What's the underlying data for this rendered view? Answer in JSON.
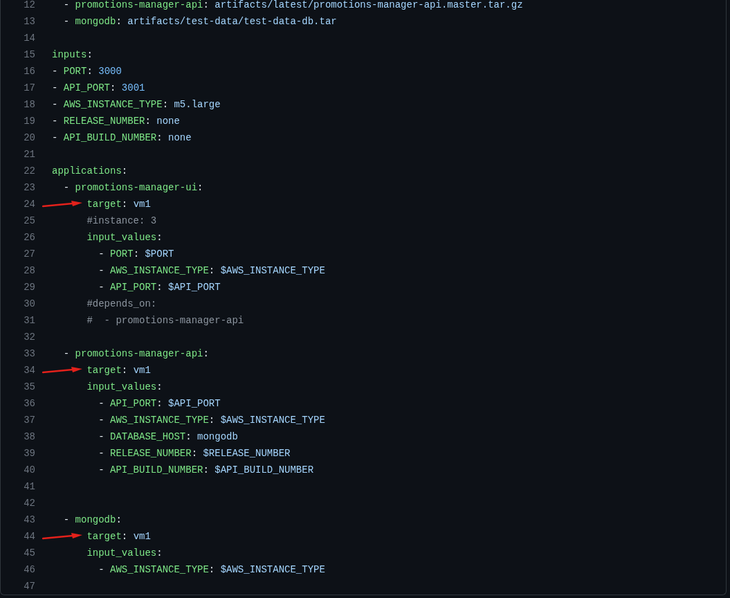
{
  "code_lines": [
    {
      "number": "12",
      "segments": [
        {
          "kind": "punct",
          "text": "  - "
        },
        {
          "kind": "key",
          "text": "promotions-manager-api"
        },
        {
          "kind": "punct",
          "text": ": "
        },
        {
          "kind": "string",
          "text": "artifacts/latest/promotions-manager-api.master.tar.gz"
        }
      ]
    },
    {
      "number": "13",
      "segments": [
        {
          "kind": "punct",
          "text": "  - "
        },
        {
          "kind": "key",
          "text": "mongodb"
        },
        {
          "kind": "punct",
          "text": ": "
        },
        {
          "kind": "string",
          "text": "artifacts/test-data/test-data-db.tar"
        }
      ]
    },
    {
      "number": "14"
    },
    {
      "number": "15",
      "segments": [
        {
          "kind": "key",
          "text": "inputs"
        },
        {
          "kind": "punct",
          "text": ":"
        }
      ]
    },
    {
      "number": "16",
      "segments": [
        {
          "kind": "punct",
          "text": "- "
        },
        {
          "kind": "key",
          "text": "PORT"
        },
        {
          "kind": "punct",
          "text": ": "
        },
        {
          "kind": "number",
          "text": "3000"
        }
      ]
    },
    {
      "number": "17",
      "segments": [
        {
          "kind": "punct",
          "text": "- "
        },
        {
          "kind": "key",
          "text": "API_PORT"
        },
        {
          "kind": "punct",
          "text": ": "
        },
        {
          "kind": "number",
          "text": "3001"
        }
      ]
    },
    {
      "number": "18",
      "segments": [
        {
          "kind": "punct",
          "text": "- "
        },
        {
          "kind": "key",
          "text": "AWS_INSTANCE_TYPE"
        },
        {
          "kind": "punct",
          "text": ": "
        },
        {
          "kind": "string",
          "text": "m5.large"
        }
      ]
    },
    {
      "number": "19",
      "segments": [
        {
          "kind": "punct",
          "text": "- "
        },
        {
          "kind": "key",
          "text": "RELEASE_NUMBER"
        },
        {
          "kind": "punct",
          "text": ": "
        },
        {
          "kind": "string",
          "text": "none"
        }
      ]
    },
    {
      "number": "20",
      "segments": [
        {
          "kind": "punct",
          "text": "- "
        },
        {
          "kind": "key",
          "text": "API_BUILD_NUMBER"
        },
        {
          "kind": "punct",
          "text": ": "
        },
        {
          "kind": "string",
          "text": "none"
        }
      ]
    },
    {
      "number": "21"
    },
    {
      "number": "22",
      "segments": [
        {
          "kind": "key",
          "text": "applications"
        },
        {
          "kind": "punct",
          "text": ":"
        }
      ]
    },
    {
      "number": "23",
      "segments": [
        {
          "kind": "punct",
          "text": "  - "
        },
        {
          "kind": "key",
          "text": "promotions-manager-ui"
        },
        {
          "kind": "punct",
          "text": ":"
        }
      ]
    },
    {
      "number": "24",
      "annotation_arrow": true,
      "segments": [
        {
          "kind": "key",
          "text": "      target"
        },
        {
          "kind": "punct",
          "text": ": "
        },
        {
          "kind": "string",
          "text": "vm1"
        }
      ]
    },
    {
      "number": "25",
      "segments": [
        {
          "kind": "comment",
          "text": "      #instance: 3"
        }
      ]
    },
    {
      "number": "26",
      "segments": [
        {
          "kind": "key",
          "text": "      input_values"
        },
        {
          "kind": "punct",
          "text": ":"
        }
      ]
    },
    {
      "number": "27",
      "segments": [
        {
          "kind": "punct",
          "text": "        - "
        },
        {
          "kind": "key",
          "text": "PORT"
        },
        {
          "kind": "punct",
          "text": ": "
        },
        {
          "kind": "string",
          "text": "$PORT"
        }
      ]
    },
    {
      "number": "28",
      "segments": [
        {
          "kind": "punct",
          "text": "        - "
        },
        {
          "kind": "key",
          "text": "AWS_INSTANCE_TYPE"
        },
        {
          "kind": "punct",
          "text": ": "
        },
        {
          "kind": "string",
          "text": "$AWS_INSTANCE_TYPE"
        }
      ]
    },
    {
      "number": "29",
      "segments": [
        {
          "kind": "punct",
          "text": "        - "
        },
        {
          "kind": "key",
          "text": "API_PORT"
        },
        {
          "kind": "punct",
          "text": ": "
        },
        {
          "kind": "string",
          "text": "$API_PORT"
        }
      ]
    },
    {
      "number": "30",
      "segments": [
        {
          "kind": "comment",
          "text": "      #depends_on:"
        }
      ]
    },
    {
      "number": "31",
      "segments": [
        {
          "kind": "comment",
          "text": "      #  - promotions-manager-api"
        }
      ]
    },
    {
      "number": "32"
    },
    {
      "number": "33",
      "segments": [
        {
          "kind": "punct",
          "text": "  - "
        },
        {
          "kind": "key",
          "text": "promotions-manager-api"
        },
        {
          "kind": "punct",
          "text": ":"
        }
      ]
    },
    {
      "number": "34",
      "annotation_arrow": true,
      "segments": [
        {
          "kind": "key",
          "text": "      target"
        },
        {
          "kind": "punct",
          "text": ": "
        },
        {
          "kind": "string",
          "text": "vm1"
        }
      ]
    },
    {
      "number": "35",
      "segments": [
        {
          "kind": "key",
          "text": "      input_values"
        },
        {
          "kind": "punct",
          "text": ":"
        }
      ]
    },
    {
      "number": "36",
      "segments": [
        {
          "kind": "punct",
          "text": "        - "
        },
        {
          "kind": "key",
          "text": "API_PORT"
        },
        {
          "kind": "punct",
          "text": ": "
        },
        {
          "kind": "string",
          "text": "$API_PORT"
        }
      ]
    },
    {
      "number": "37",
      "segments": [
        {
          "kind": "punct",
          "text": "        - "
        },
        {
          "kind": "key",
          "text": "AWS_INSTANCE_TYPE"
        },
        {
          "kind": "punct",
          "text": ": "
        },
        {
          "kind": "string",
          "text": "$AWS_INSTANCE_TYPE"
        }
      ]
    },
    {
      "number": "38",
      "segments": [
        {
          "kind": "punct",
          "text": "        - "
        },
        {
          "kind": "key",
          "text": "DATABASE_HOST"
        },
        {
          "kind": "punct",
          "text": ": "
        },
        {
          "kind": "string",
          "text": "mongodb"
        }
      ]
    },
    {
      "number": "39",
      "segments": [
        {
          "kind": "punct",
          "text": "        - "
        },
        {
          "kind": "key",
          "text": "RELEASE_NUMBER"
        },
        {
          "kind": "punct",
          "text": ": "
        },
        {
          "kind": "string",
          "text": "$RELEASE_NUMBER"
        }
      ]
    },
    {
      "number": "40",
      "segments": [
        {
          "kind": "punct",
          "text": "        - "
        },
        {
          "kind": "key",
          "text": "API_BUILD_NUMBER"
        },
        {
          "kind": "punct",
          "text": ": "
        },
        {
          "kind": "string",
          "text": "$API_BUILD_NUMBER"
        }
      ]
    },
    {
      "number": "41"
    },
    {
      "number": "42"
    },
    {
      "number": "43",
      "segments": [
        {
          "kind": "punct",
          "text": "  - "
        },
        {
          "kind": "key",
          "text": "mongodb"
        },
        {
          "kind": "punct",
          "text": ":"
        }
      ]
    },
    {
      "number": "44",
      "annotation_arrow": true,
      "segments": [
        {
          "kind": "key",
          "text": "      target"
        },
        {
          "kind": "punct",
          "text": ": "
        },
        {
          "kind": "string",
          "text": "vm1"
        }
      ]
    },
    {
      "number": "45",
      "segments": [
        {
          "kind": "key",
          "text": "      input_values"
        },
        {
          "kind": "punct",
          "text": ":"
        }
      ]
    },
    {
      "number": "46",
      "segments": [
        {
          "kind": "punct",
          "text": "        - "
        },
        {
          "kind": "key",
          "text": "AWS_INSTANCE_TYPE"
        },
        {
          "kind": "punct",
          "text": ": "
        },
        {
          "kind": "string",
          "text": "$AWS_INSTANCE_TYPE"
        }
      ]
    },
    {
      "number": "47"
    }
  ]
}
